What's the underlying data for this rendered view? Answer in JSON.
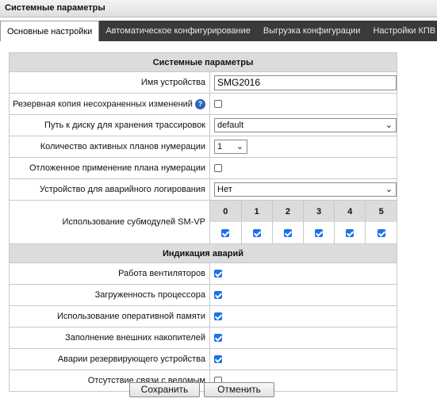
{
  "window": {
    "title": "Системные параметры"
  },
  "tabs": [
    {
      "label": "Основные настройки",
      "active": true
    },
    {
      "label": "Автоматическое конфигурирование",
      "active": false
    },
    {
      "label": "Выгрузка конфигурации",
      "active": false
    },
    {
      "label": "Настройки КПВ",
      "active": false
    }
  ],
  "system": {
    "section_title": "Системные параметры",
    "device_name": {
      "label": "Имя устройства",
      "value": "SMG2016"
    },
    "backup_unsaved": {
      "label": "Резервная копия несохраненных изменений",
      "checked": false,
      "help_icon": "help-icon"
    },
    "trace_path": {
      "label": "Путь к диску для хранения трассировок",
      "value": "default"
    },
    "active_plans": {
      "label": "Количество активных планов нумерации",
      "value": "1"
    },
    "deferred_plan": {
      "label": "Отложенное применение плана нумерации",
      "checked": false
    },
    "crash_log_device": {
      "label": "Устройство для аварийного логирования",
      "value": "Нет"
    },
    "smvp": {
      "label": "Использование субмодулей SM-VP",
      "modules": [
        {
          "index": "0",
          "checked": true
        },
        {
          "index": "1",
          "checked": true
        },
        {
          "index": "2",
          "checked": true
        },
        {
          "index": "3",
          "checked": true
        },
        {
          "index": "4",
          "checked": true
        },
        {
          "index": "5",
          "checked": true
        }
      ]
    }
  },
  "alarms": {
    "section_title": "Индикация аварий",
    "items": [
      {
        "label": "Работа вентиляторов",
        "checked": true
      },
      {
        "label": "Загруженность процессора",
        "checked": true
      },
      {
        "label": "Использование оперативной памяти",
        "checked": true
      },
      {
        "label": "Заполнение внешних накопителей",
        "checked": true
      },
      {
        "label": "Аварии резервирующего устройства",
        "checked": true
      },
      {
        "label": "Отсутствие связи с ведомым",
        "checked": false
      }
    ]
  },
  "buttons": {
    "save_label": "Сохранить",
    "cancel_label": "Отменить"
  },
  "colors": {
    "tab_bar": "#3a3a3a",
    "section_header": "#dcdcdc",
    "checkbox_on": "#1a73e8",
    "help_icon": "#2e63b8"
  }
}
